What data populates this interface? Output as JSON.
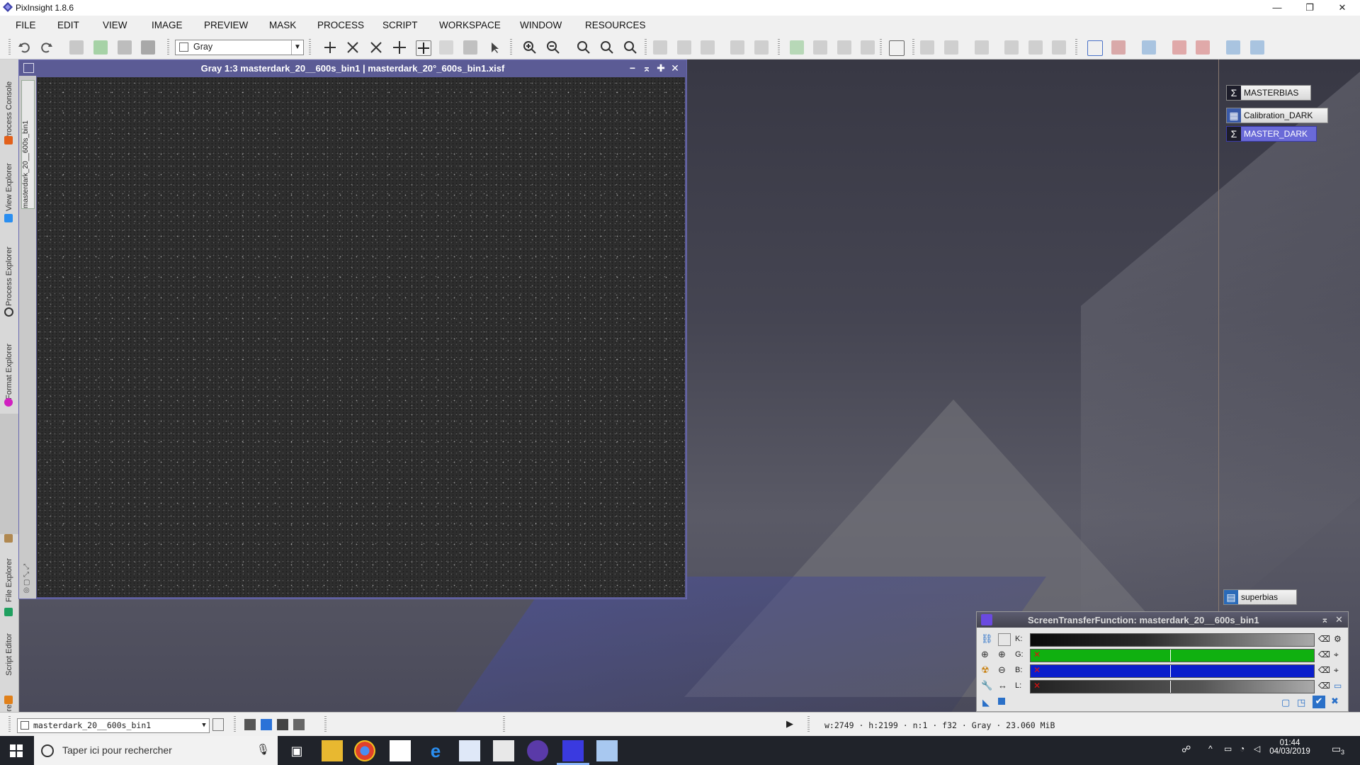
{
  "window": {
    "title": "PixInsight 1.8.6",
    "controls": {
      "minimize": "—",
      "maximize": "❐",
      "close": "✕"
    }
  },
  "menu": [
    "FILE",
    "EDIT",
    "VIEW",
    "IMAGE",
    "PREVIEW",
    "MASK",
    "PROCESS",
    "SCRIPT",
    "WORKSPACE",
    "WINDOW",
    "RESOURCES"
  ],
  "toolbar": {
    "view_selector": "Gray"
  },
  "left_dock_tabs": [
    "Process Console",
    "View Explorer",
    "Process Explorer",
    "Format Explorer",
    "File Explorer",
    "Script Editor",
    "History Explorer"
  ],
  "image_window": {
    "title": "Gray 1:3 masterdark_20__600s_bin1 | masterdark_20°_600s_bin1.xisf",
    "side_tab": "masterdark_20__600s_bin1",
    "controls": {
      "minimize": "−",
      "shade": "⌅",
      "maximize": "✚",
      "close": "✕"
    }
  },
  "workspace_icons": [
    {
      "label": "MASTERBIAS",
      "icon": "sigma-icon"
    },
    {
      "label": "Calibration_DARK",
      "icon": "process-container-icon"
    },
    {
      "label": "MASTER_DARK",
      "icon": "sigma-icon",
      "selected": true
    },
    {
      "label": "superbias",
      "icon": "superbias-icon"
    }
  ],
  "stf": {
    "title": "ScreenTransferFunction: masterdark_20__600s_bin1",
    "channels": [
      {
        "label": "K:",
        "color": "#111111",
        "active": false
      },
      {
        "label": "G:",
        "color": "#10b010",
        "active": true
      },
      {
        "label": "B:",
        "color": "#0a1ecc",
        "active": true
      },
      {
        "label": "L:",
        "color": "#222222",
        "active": true
      }
    ],
    "x_mark": "✕"
  },
  "statusbar": {
    "view": "masterdark_20__600s_bin1",
    "info": "w:2749 · h:2199 · n:1 · f32 · Gray · 23.060 MiB"
  },
  "taskbar": {
    "search_placeholder": "Taper ici pour rechercher",
    "time": "01:44",
    "date": "04/03/2019",
    "notif_count": "3"
  },
  "colors": {
    "image_window_title": "#5b5b95",
    "selected_icon": "#6a6ad8"
  }
}
